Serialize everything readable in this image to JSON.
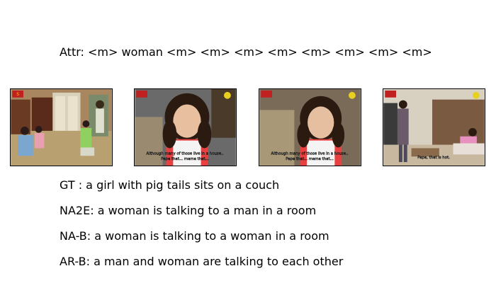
{
  "attributes": {
    "label": "Attr:",
    "tokens": "<m> woman <m> <m> <m> <m> <m> <m> <m> <m>"
  },
  "frames": [
    {
      "description_icon": "living-room-scene-icon",
      "subtitle": ""
    },
    {
      "description_icon": "girl-closeup-scene-icon",
      "subtitle_line1": "Although many of those live in a house..",
      "subtitle_line2": "Papa that... mama that..."
    },
    {
      "description_icon": "girl-closeup-scene-icon",
      "subtitle_line1": "Although many of those live in a house..",
      "subtitle_line2": "Papa that... mama that..."
    },
    {
      "description_icon": "room-wide-scene-icon",
      "subtitle_line1": "Papa, that is hot."
    }
  ],
  "captions": [
    {
      "label": "GT  :",
      "text": "a girl with pig tails sits on a couch"
    },
    {
      "label": "NA2E:",
      "text": "a woman is talking to a man in a room"
    },
    {
      "label": "NA-B:",
      "text": "a woman is talking to a woman in a room"
    },
    {
      "label": "AR-B:",
      "text": "a man and woman are talking to each other"
    }
  ]
}
